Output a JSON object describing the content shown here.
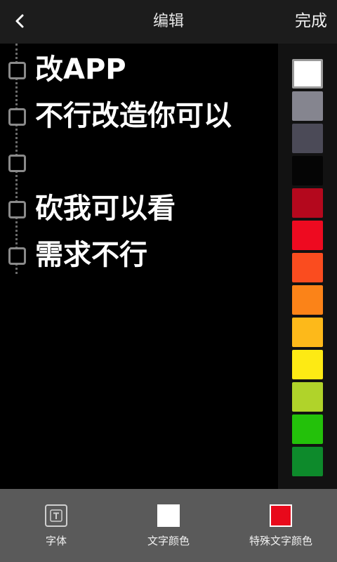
{
  "header": {
    "title": "编辑",
    "done_label": "完成",
    "back_icon": "chevron-left-icon"
  },
  "editor": {
    "lines": [
      {
        "text": "改APP"
      },
      {
        "text": "不行改造你可以"
      },
      {
        "text": ""
      },
      {
        "text": "砍我可以看"
      },
      {
        "text": "需求不行"
      }
    ]
  },
  "palette": {
    "selected_index": 0,
    "colors": [
      "#ffffff",
      "#85858f",
      "#4b4a57",
      "#050505",
      "#b4081d",
      "#ee0a20",
      "#fa4c1f",
      "#fb8318",
      "#fdb91a",
      "#fdea14",
      "#b0d32a",
      "#23c10a",
      "#0d8a2b"
    ]
  },
  "toolbar": {
    "font_label": "字体",
    "font_icon": "font-t-icon",
    "text_color_label": "文字颜色",
    "text_color_value": "#ffffff",
    "special_color_label": "特殊文字颜色",
    "special_color_value": "#e8091b"
  }
}
